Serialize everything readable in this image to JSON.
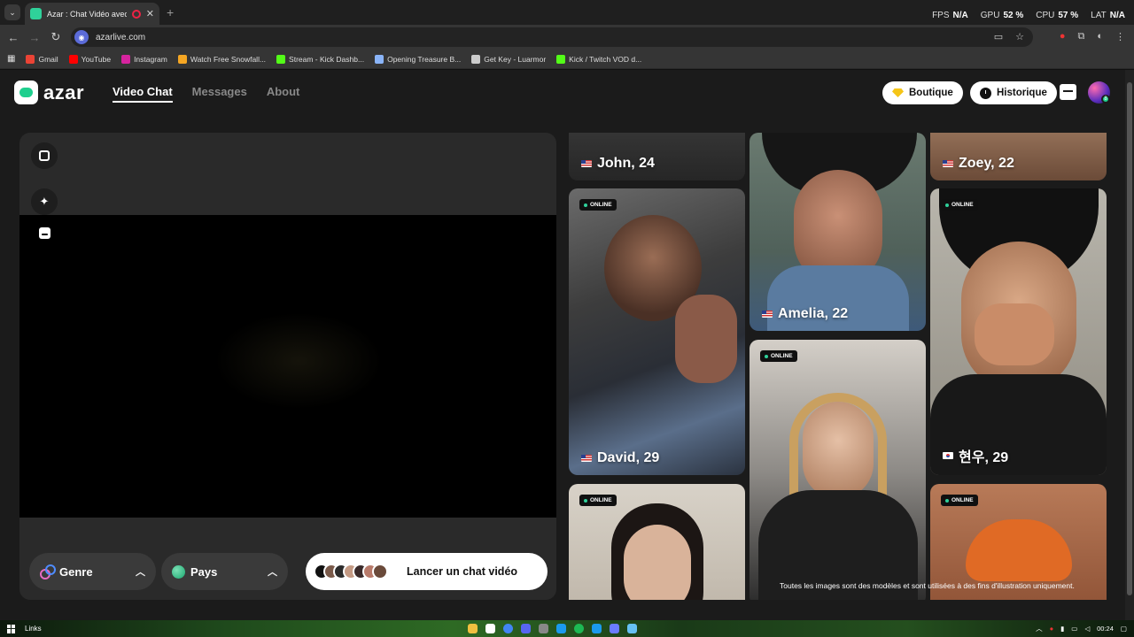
{
  "browser": {
    "tab_title": "Azar : Chat Vidéo avec de n",
    "tab_close": "✕",
    "new_tab": "+",
    "perf": [
      {
        "label": "FPS",
        "value": "N/A"
      },
      {
        "label": "GPU",
        "value": "52 %"
      },
      {
        "label": "CPU",
        "value": "57 %"
      },
      {
        "label": "LAT",
        "value": "N/A"
      }
    ],
    "url": "azarlive.com",
    "bookmarks": [
      {
        "label": "Gmail",
        "color": "#ea4335"
      },
      {
        "label": "YouTube",
        "color": "#ff0000"
      },
      {
        "label": "Instagram",
        "color": "#d6249f"
      },
      {
        "label": "Watch Free Snowfall...",
        "color": "#f5a623"
      },
      {
        "label": "Stream - Kick Dashb...",
        "color": "#53fc18"
      },
      {
        "label": "Opening Treasure B...",
        "color": "#8ab4f8"
      },
      {
        "label": "Get Key - Luarmor",
        "color": "#cccccc"
      },
      {
        "label": "Kick / Twitch VOD d...",
        "color": "#53fc18"
      }
    ]
  },
  "site": {
    "logo_text": "azar",
    "nav": [
      "Video Chat",
      "Messages",
      "About"
    ],
    "boutique_label": "Boutique",
    "historique_label": "Historique",
    "avatar_badge": "8",
    "genre_label": "Genre",
    "pays_label": "Pays",
    "launch_label": "Lancer un chat vidéo",
    "launch_faces": [
      "#7a5a4a",
      "#2b2b2b",
      "#c49a84",
      "#3a2a2a",
      "#b87a6a",
      "#6a4a3a"
    ],
    "online_label": "ONLINE",
    "cards": [
      {
        "name": "John, 24",
        "flag": "us",
        "online": false
      },
      {
        "name": "Zoey, 22",
        "flag": "us",
        "online": false
      },
      {
        "name": "David, 29",
        "flag": "us",
        "online": true
      },
      {
        "name": "Amelia, 22",
        "flag": "us",
        "online": false
      },
      {
        "name": "현우, 29",
        "flag": "kr",
        "online": true
      },
      {
        "name": "",
        "flag": "",
        "online": true
      },
      {
        "name": "",
        "flag": "",
        "online": true
      },
      {
        "name": "",
        "flag": "",
        "online": true
      }
    ],
    "disclaimer": "Toutes les images sont des modèles et sont utilisées à des fins d'illustration uniquement."
  },
  "taskbar": {
    "links_label": "Links",
    "time": "00:24",
    "app_colors": [
      "#f0c040",
      "#ffffff",
      "#4285f4",
      "#5865f2",
      "#888888",
      "#1b9aee",
      "#1db954",
      "#1b9aee",
      "#6a7cff",
      "#66c0f4"
    ]
  }
}
